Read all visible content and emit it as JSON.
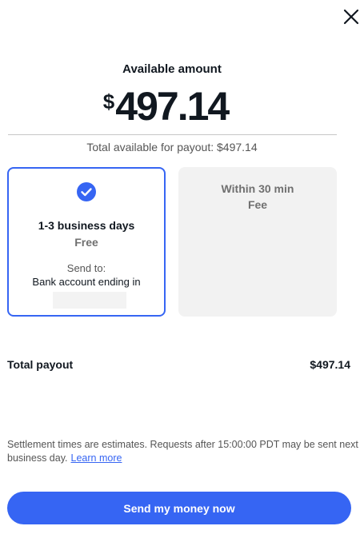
{
  "header": {
    "close_icon": "close-icon"
  },
  "summary": {
    "label": "Available amount",
    "currency_symbol": "$",
    "amount": "497.14",
    "total_available_text": "Total available for payout: $497.14"
  },
  "options": [
    {
      "title": "1-3 business days",
      "fee": "Free",
      "selected": true,
      "icon": "checkmark-circle-icon",
      "send_to_label": "Send to:",
      "bank_label": "Bank account ending in"
    },
    {
      "title": "Within 30 min",
      "fee": "Fee",
      "selected": false
    }
  ],
  "payout": {
    "label": "Total payout",
    "value": "$497.14"
  },
  "disclaimer": {
    "text": "Settlement times are estimates. Requests after 15:00:00 PDT may be sent next business day.",
    "link_label": "Learn more"
  },
  "cta": {
    "label": "Send my money now"
  },
  "colors": {
    "accent": "#3665f3",
    "text": "#111820",
    "muted": "#707070",
    "card_bg": "#f2f2f2"
  }
}
